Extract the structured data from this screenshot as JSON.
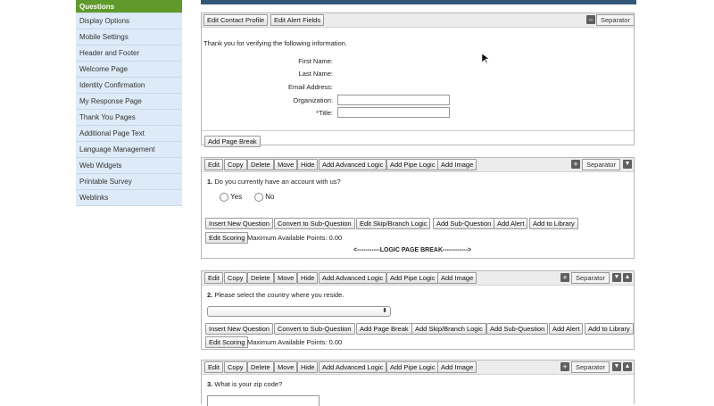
{
  "sidebar": {
    "items": [
      {
        "label": "Questions",
        "active": true
      },
      {
        "label": "Display Options"
      },
      {
        "label": "Mobile Settings"
      },
      {
        "label": "Header and Footer"
      },
      {
        "label": "Welcome Page"
      },
      {
        "label": "Identity Confirmation"
      },
      {
        "label": "My Response Page"
      },
      {
        "label": "Thank You Pages"
      },
      {
        "label": "Additional Page Text"
      },
      {
        "label": "Language Management"
      },
      {
        "label": "Web Widgets"
      },
      {
        "label": "Printable Survey"
      },
      {
        "label": "Weblinks"
      }
    ]
  },
  "contact": {
    "btn_edit_profile": "Edit Contact Profile",
    "btn_edit_alert": "Edit Alert Fields",
    "separator": "Separator",
    "thank_you": "Thank you for verifying the following information.",
    "fields": [
      "First Name:",
      "Last Name:",
      "Email Address:",
      "Organization:",
      "*Title:"
    ],
    "add_page_break": "Add Page Break"
  },
  "toolbar_buttons": [
    "Edit",
    "Copy",
    "Delete",
    "Move",
    "Hide",
    "Add Advanced Logic",
    "Add Pipe Logic",
    "Add Image"
  ],
  "q1": {
    "number": "1.",
    "text": "Do you currently have an account with us?",
    "options": [
      "Yes",
      "No"
    ],
    "actions": [
      "Insert New Question",
      "Convert to Sub-Question",
      "Edit Skip/Branch Logic",
      "Add Sub-Question",
      "Add Alert",
      "Add to Library"
    ],
    "edit_scoring": "Edit Scoring",
    "max_points": "Maximum Available Points: 0.00",
    "logic_break": "<-----------LOGIC PAGE BREAK------------>"
  },
  "q2": {
    "number": "2.",
    "text": "Please select the country where you reside.",
    "actions": [
      "Insert New Question",
      "Convert to Sub-Question",
      "Add Page Break",
      "Add Skip/Branch Logic",
      "Add Sub-Question",
      "Add Alert",
      "Add to Library"
    ],
    "edit_scoring": "Edit Scoring",
    "max_points": "Maximum Available Points: 0.00"
  },
  "q3": {
    "number": "3.",
    "text": "What is your zip code?"
  },
  "separator": "Separator",
  "icons": {
    "plus": "plus-icon",
    "minus": "minus-icon",
    "down": "arrow-down-icon",
    "up": "arrow-up-icon"
  }
}
